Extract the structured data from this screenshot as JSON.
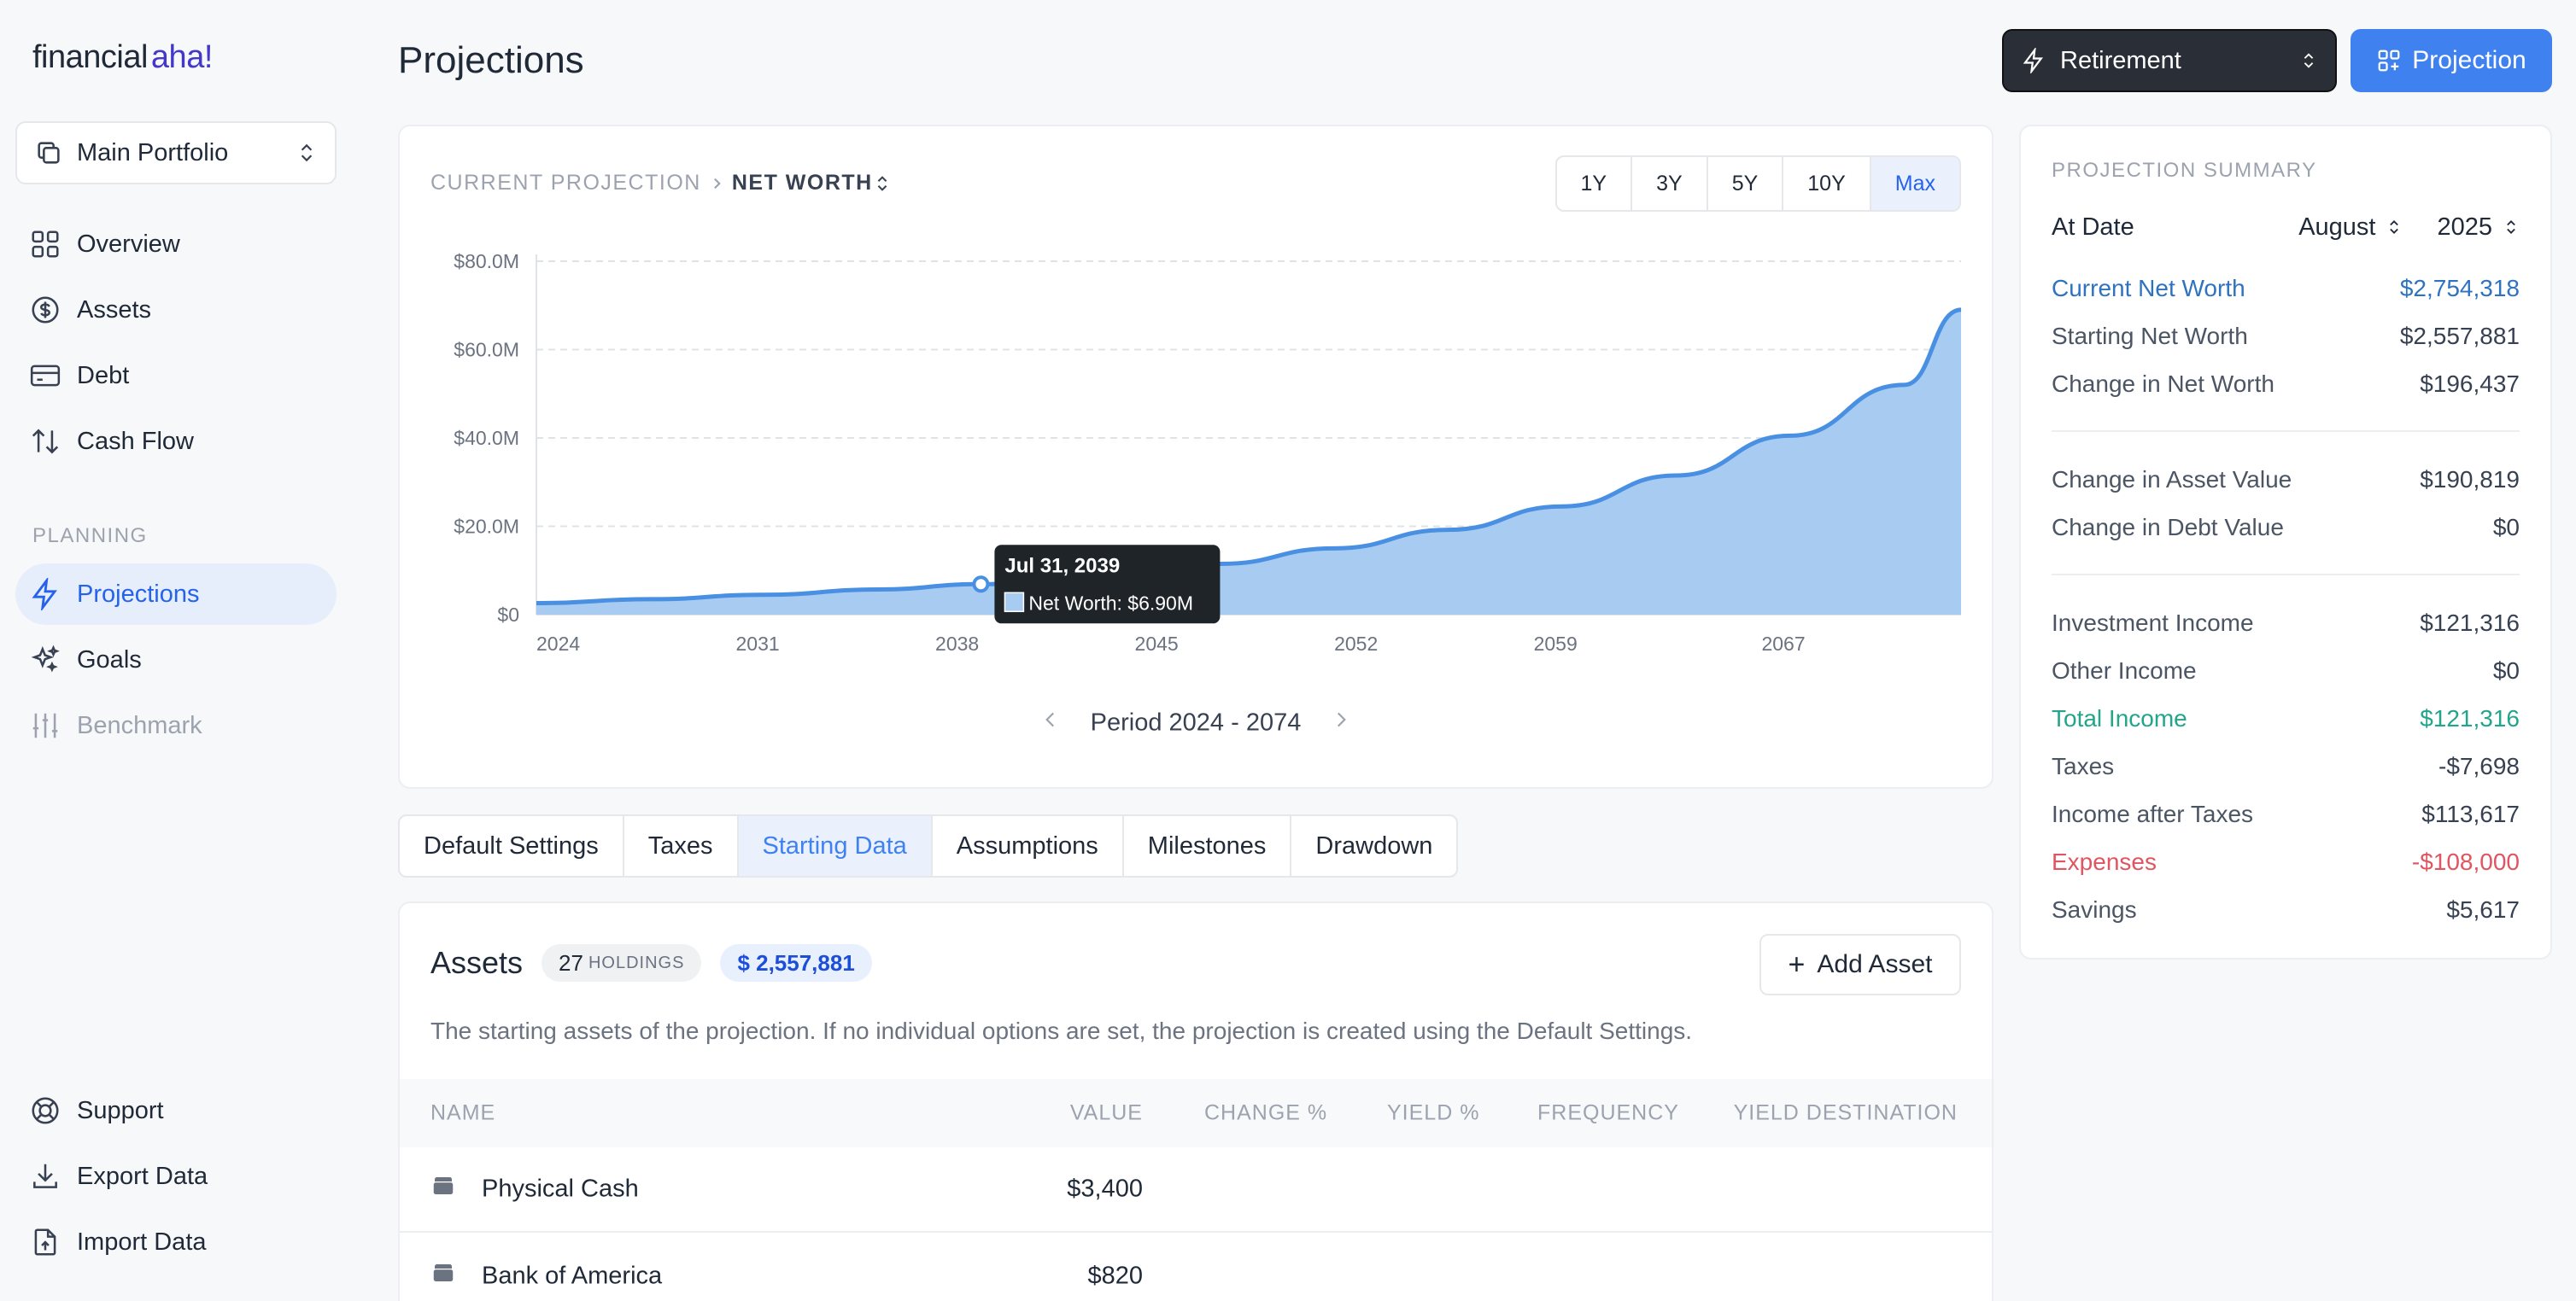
{
  "logo": {
    "part1": "financial",
    "part2": "aha!"
  },
  "portfolio": {
    "label": "Main Portfolio"
  },
  "sidebar": {
    "items": [
      {
        "label": "Overview"
      },
      {
        "label": "Assets"
      },
      {
        "label": "Debt"
      },
      {
        "label": "Cash Flow"
      }
    ],
    "section_label": "PLANNING",
    "planning_items": [
      {
        "label": "Projections"
      },
      {
        "label": "Goals"
      },
      {
        "label": "Benchmark"
      }
    ],
    "bottom_items": [
      {
        "label": "Support"
      },
      {
        "label": "Export Data"
      },
      {
        "label": "Import Data"
      }
    ]
  },
  "header": {
    "title": "Projections",
    "scenario_select": "Retirement",
    "projection_button": "Projection"
  },
  "chart_card": {
    "crumb_current": "CURRENT PROJECTION",
    "crumb_metric": "NET WORTH",
    "ranges": [
      "1Y",
      "3Y",
      "5Y",
      "10Y",
      "Max"
    ],
    "selected_range": "Max",
    "period_label": "Period 2024 - 2074",
    "tooltip": {
      "date": "Jul 31, 2039",
      "label": "Net Worth: $6.90M"
    }
  },
  "chart_data": {
    "type": "area",
    "title": "",
    "xlabel": "",
    "ylabel": "",
    "x_ticks": [
      "2024",
      "2031",
      "2038",
      "2045",
      "2052",
      "2059",
      "2067"
    ],
    "y_ticks": [
      "$0",
      "$20.0M",
      "$40.0M",
      "$60.0M",
      "$80.0M"
    ],
    "ylim": [
      0,
      80
    ],
    "y_unit": "$M",
    "grid": true,
    "series": [
      {
        "name": "Net Worth",
        "color": "#4a90e2",
        "x": [
          2024,
          2028,
          2032,
          2036,
          2039.6,
          2044,
          2048,
          2052,
          2056,
          2060,
          2064,
          2068,
          2072,
          2074
        ],
        "values": [
          2.6,
          3.5,
          4.5,
          5.7,
          6.9,
          9.0,
          11.5,
          15.0,
          19.2,
          24.5,
          31.5,
          40.5,
          52.0,
          69.0
        ]
      }
    ]
  },
  "tabs": [
    "Default Settings",
    "Taxes",
    "Starting Data",
    "Assumptions",
    "Milestones",
    "Drawdown"
  ],
  "selected_tab": "Starting Data",
  "assets": {
    "title": "Assets",
    "holdings_count": "27",
    "holdings_label": "HOLDINGS",
    "total": "$ 2,557,881",
    "add_button": "Add Asset",
    "description": "The starting assets of the projection. If no individual options are set, the projection is created using the Default Settings.",
    "columns": [
      "NAME",
      "VALUE",
      "CHANGE %",
      "YIELD %",
      "FREQUENCY",
      "YIELD DESTINATION"
    ],
    "rows": [
      {
        "name": "Physical Cash",
        "value": "$3,400"
      },
      {
        "name": "Bank of America",
        "value": "$820"
      }
    ]
  },
  "summary": {
    "title": "PROJECTION SUMMARY",
    "at_date_label": "At Date",
    "month": "August",
    "year": "2025",
    "group1": [
      {
        "label": "Current Net Worth",
        "value": "$2,754,318"
      },
      {
        "label": "Starting Net Worth",
        "value": "$2,557,881"
      },
      {
        "label": "Change in Net Worth",
        "value": "$196,437"
      }
    ],
    "group2": [
      {
        "label": "Change in Asset Value",
        "value": "$190,819"
      },
      {
        "label": "Change in Debt Value",
        "value": "$0"
      }
    ],
    "group3": [
      {
        "label": "Investment Income",
        "value": "$121,316"
      },
      {
        "label": "Other Income",
        "value": "$0"
      },
      {
        "label": "Total Income",
        "value": "$121,316"
      },
      {
        "label": "Taxes",
        "value": "-$7,698"
      },
      {
        "label": "Income after Taxes",
        "value": "$113,617"
      },
      {
        "label": "Expenses",
        "value": "-$108,000"
      },
      {
        "label": "Savings",
        "value": "$5,617"
      }
    ]
  }
}
